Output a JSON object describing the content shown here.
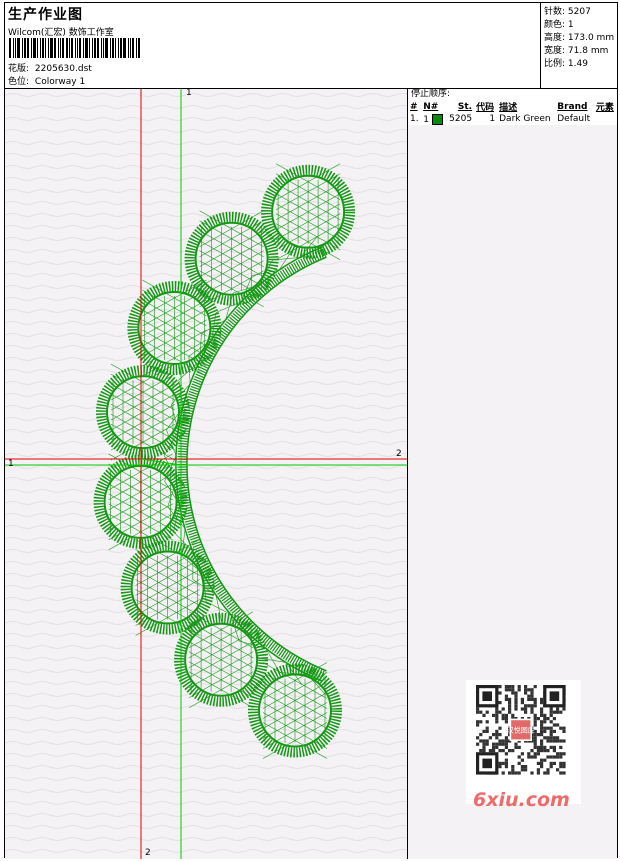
{
  "header": {
    "title": "生产作业图",
    "subtitle": "Wilcom(汇宏) 数饰工作室",
    "design_label": "花版:",
    "design_value": "2205630.dst",
    "colorway_label": "色位:",
    "colorway_value": "Colorway 1"
  },
  "specs": [
    {
      "label": "针数:",
      "value": "5207"
    },
    {
      "label": "颜色:",
      "value": "1"
    },
    {
      "label": "高度:",
      "value": "173.0 mm"
    },
    {
      "label": "宽度:",
      "value": "71.8 mm"
    },
    {
      "label": "比例:",
      "value": "1.49"
    }
  ],
  "stop_sequence": {
    "heading": "停止顺序:",
    "columns": [
      "#",
      "N#",
      "St.",
      "代码",
      "描述",
      "Brand",
      "元素"
    ],
    "rows": [
      {
        "index": "1.",
        "needle": "1",
        "color": "#0a8a0a",
        "stitches": "5205",
        "code": "1",
        "description": "Dark Green",
        "brand": "Default",
        "element": ""
      }
    ]
  },
  "guides": {
    "top_vertical": "1",
    "left_horizontal": "1",
    "right_horizontal": "2",
    "bottom_vertical": "2"
  },
  "watermark": {
    "text": "6xiu.com",
    "stamp": "汉悦图库"
  },
  "colors": {
    "thread": "#149814",
    "guide_red": "#e00000",
    "guide_green": "#00cc00"
  }
}
